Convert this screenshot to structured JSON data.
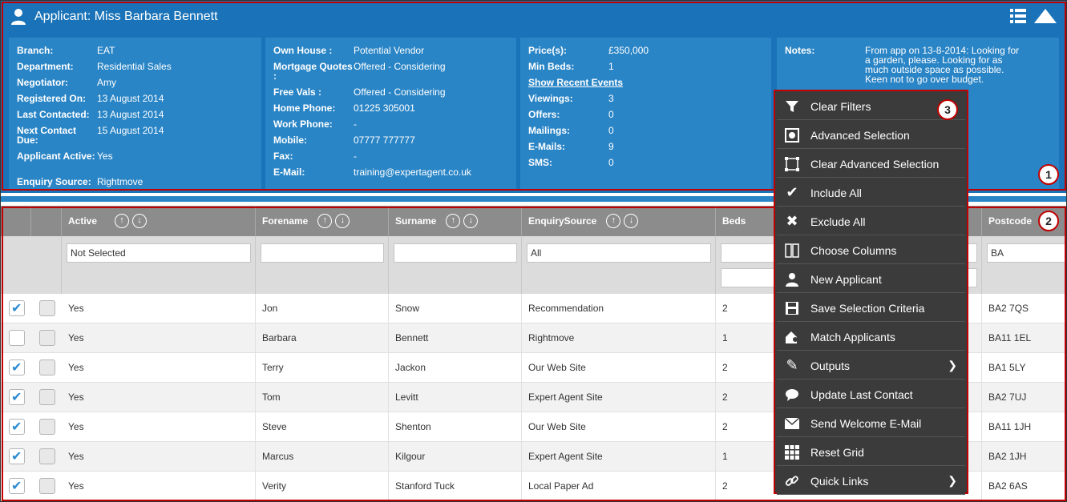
{
  "header": {
    "title": "Applicant: Miss Barbara Bennett",
    "colors": {
      "bar": "#1a73b8",
      "box": "#2a85c6",
      "outline": "#c00000"
    }
  },
  "info": {
    "col1": [
      {
        "label": "Branch:",
        "value": "EAT"
      },
      {
        "label": "Department:",
        "value": "Residential Sales"
      },
      {
        "label": "Negotiator:",
        "value": "Amy"
      },
      {
        "label": "Registered On:",
        "value": "13 August 2014"
      },
      {
        "label": "Last Contacted:",
        "value": "13 August 2014"
      },
      {
        "label": "Next Contact Due:",
        "value": "15 August 2014"
      },
      {
        "label": "Applicant Active:",
        "value": "Yes"
      },
      {
        "label": "Enquiry Source:",
        "value": "Rightmove"
      }
    ],
    "col2": [
      {
        "label": "Own House :",
        "value": "Potential Vendor"
      },
      {
        "label": "Mortgage Quotes :",
        "value": "Offered - Considering"
      },
      {
        "label": "Free Vals :",
        "value": "Offered - Considering"
      },
      {
        "label": "Home Phone:",
        "value": "01225 305001"
      },
      {
        "label": "Work Phone:",
        "value": "-"
      },
      {
        "label": "Mobile:",
        "value": "07777 777777"
      },
      {
        "label": "Fax:",
        "value": "-"
      },
      {
        "label": "E-Mail:",
        "value": "training@expertagent.co.uk"
      }
    ],
    "col3": [
      {
        "label": "Price(s):",
        "value": "£350,000"
      },
      {
        "label": "Min Beds:",
        "value": "1"
      },
      {
        "label": "Show Recent Events",
        "value": ""
      },
      {
        "label": "Viewings:",
        "value": "3"
      },
      {
        "label": "Offers:",
        "value": "0"
      },
      {
        "label": "Mailings:",
        "value": "0"
      },
      {
        "label": "E-Mails:",
        "value": "9"
      },
      {
        "label": "SMS:",
        "value": "0"
      }
    ],
    "notes_label": "Notes:",
    "notes_text": "From app on 13-8-2014: Looking for a garden, please. Looking for as much outside space as possible. Keen not to go over budget."
  },
  "grid": {
    "columns": [
      "Active",
      "Forename",
      "Surname",
      "EnquirySource",
      "Beds",
      "Postcode"
    ],
    "filters": {
      "active": "Not Selected",
      "enquiry": "All",
      "postcode": "BA"
    },
    "rows": [
      {
        "active": "Yes",
        "forename": "Jon",
        "surname": "Snow",
        "source": "Recommendation",
        "beds": "2",
        "postcode": "BA2 7QS"
      },
      {
        "active": "Yes",
        "forename": "Barbara",
        "surname": "Bennett",
        "source": "Rightmove",
        "beds": "1",
        "postcode": "BA11 1EL"
      },
      {
        "active": "Yes",
        "forename": "Terry",
        "surname": "Jackon",
        "source": "Our Web Site",
        "beds": "2",
        "postcode": "BA1 5LY"
      },
      {
        "active": "Yes",
        "forename": "Tom",
        "surname": "Levitt",
        "source": "Expert Agent Site",
        "beds": "2",
        "postcode": "BA2 7UJ"
      },
      {
        "active": "Yes",
        "forename": "Steve",
        "surname": "Shenton",
        "source": "Our Web Site",
        "beds": "2",
        "postcode": "BA11 1JH"
      },
      {
        "active": "Yes",
        "forename": "Marcus",
        "surname": "Kilgour",
        "source": "Expert Agent Site",
        "beds": "1",
        "postcode": "BA2 1JH"
      },
      {
        "active": "Yes",
        "forename": "Verity",
        "surname": "Stanford Tuck",
        "source": "Local Paper Ad",
        "beds": "2",
        "postcode": "BA2 6AS"
      }
    ]
  },
  "menu": {
    "items": [
      {
        "label": "Clear Filters",
        "icon": "filter-icon"
      },
      {
        "label": "Advanced Selection",
        "icon": "advanced-selection-icon"
      },
      {
        "label": "Clear Advanced Selection",
        "icon": "clear-selection-icon"
      },
      {
        "label": "Include All",
        "icon": "check-icon"
      },
      {
        "label": "Exclude All",
        "icon": "x-icon"
      },
      {
        "label": "Choose Columns",
        "icon": "columns-icon"
      },
      {
        "label": "New Applicant",
        "icon": "user-icon"
      },
      {
        "label": "Save Selection Criteria",
        "icon": "save-icon"
      },
      {
        "label": "Match Applicants",
        "icon": "match-icon"
      },
      {
        "label": "Outputs",
        "icon": "pencil-icon"
      },
      {
        "label": "Update Last Contact",
        "icon": "speech-bubble-icon"
      },
      {
        "label": "Send Welcome E-Mail",
        "icon": "envelope-icon"
      },
      {
        "label": "Reset Grid",
        "icon": "grid-icon"
      },
      {
        "label": "Quick Links",
        "icon": "link-icon"
      }
    ]
  },
  "callouts": [
    "1",
    "2",
    "3"
  ]
}
